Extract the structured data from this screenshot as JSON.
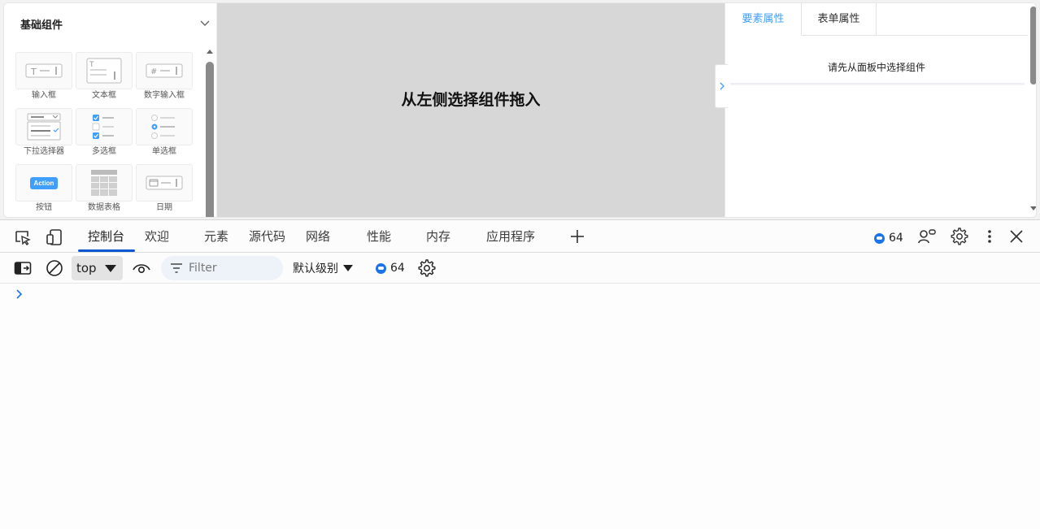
{
  "app": {
    "palette": {
      "title": "基础组件",
      "items": [
        {
          "label": "输入框",
          "icon": "input-field-icon"
        },
        {
          "label": "文本框",
          "icon": "textarea-icon"
        },
        {
          "label": "数字输入框",
          "icon": "number-input-icon"
        },
        {
          "label": "下拉选择器",
          "icon": "select-icon"
        },
        {
          "label": "多选框",
          "icon": "checkbox-icon"
        },
        {
          "label": "单选框",
          "icon": "radio-icon"
        },
        {
          "label": "按钮",
          "icon": "button-icon",
          "button_text": "Action"
        },
        {
          "label": "数据表格",
          "icon": "table-icon"
        },
        {
          "label": "日期",
          "icon": "date-icon"
        }
      ]
    },
    "canvas": {
      "hint": "从左侧选择组件拖入"
    },
    "right_panel": {
      "tabs": [
        {
          "label": "要素属性",
          "active": true
        },
        {
          "label": "表单属性",
          "active": false
        }
      ],
      "empty_message": "请先从面板中选择组件"
    }
  },
  "devtools": {
    "tabs": [
      {
        "label": "控制台",
        "active": true
      },
      {
        "label": "欢迎"
      },
      {
        "label": "元素"
      },
      {
        "label": "源代码"
      },
      {
        "label": "网络"
      },
      {
        "label": "性能"
      },
      {
        "label": "内存"
      },
      {
        "label": "应用程序"
      }
    ],
    "issues_count": "64",
    "toolbar": {
      "context": "top",
      "filter_placeholder": "Filter",
      "log_level": "默认级别",
      "issues_count": "64"
    }
  },
  "colors": {
    "accent": "#409eff",
    "devtools_active": "#0b57d0",
    "canvas_bg": "#d7d7d7",
    "issue_blue": "#1a73e8"
  }
}
